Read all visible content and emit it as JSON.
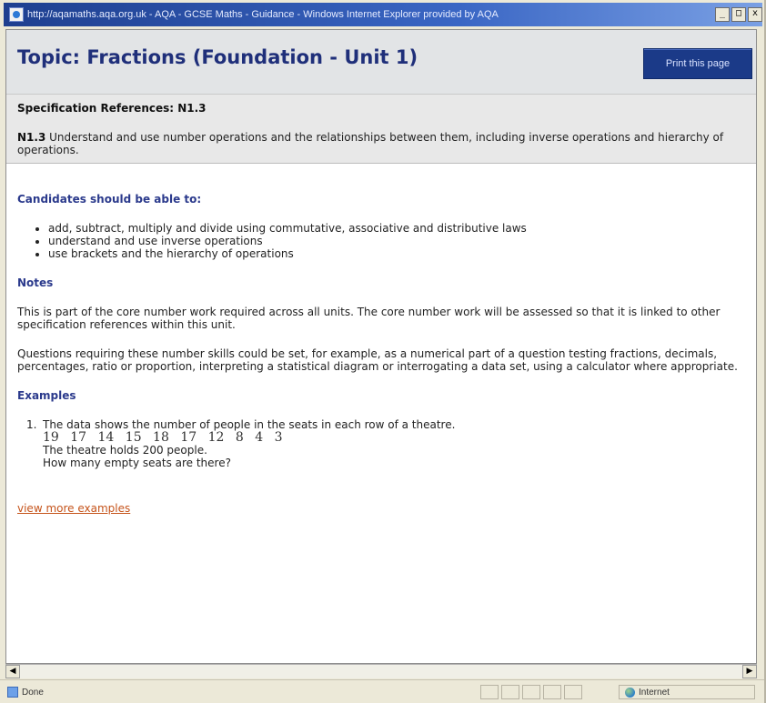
{
  "window": {
    "title": "http://aqamaths.aqa.org.uk - AQA - GCSE Maths - Guidance - Windows Internet Explorer provided by AQA",
    "controls": [
      "_",
      "□",
      "x"
    ]
  },
  "header": {
    "page_title": "Topic: Fractions (Foundation - Unit 1)",
    "print_label": "Print this page"
  },
  "spec": {
    "reference": "Specification References: N1.3",
    "code": "N1.3",
    "description": " Understand and use number operations and the relationships between them, including inverse operations and hierarchy of operations."
  },
  "candidates": {
    "heading": "Candidates should be able to:",
    "items": [
      "add, subtract, multiply and divide using commutative, associative and distributive laws",
      "understand and use inverse operations",
      "use brackets and the hierarchy of operations"
    ]
  },
  "notes": {
    "heading": "Notes",
    "paragraphs": [
      "This is part of the core number work required across all units. The core number work will be assessed so that it is linked to other specification references within this unit.",
      "Questions requiring these number skills could be set, for example, as a numerical part of a question testing fractions, decimals, percentages, ratio or proportion, interpreting a statistical diagram or interrogating a data set, using a calculator where appropriate."
    ]
  },
  "examples": {
    "heading": "Examples",
    "items": [
      {
        "number": "1.",
        "line1": "The data shows the number of people in the seats in each row of a theatre.",
        "numbers": "19  17  14  15  18  17  12  8  4  3",
        "line2": "The theatre holds 200 people.",
        "line3": "How many empty seats are there?"
      }
    ],
    "more_link": "view more examples"
  },
  "status": {
    "done": "Done",
    "zone": "Internet"
  }
}
